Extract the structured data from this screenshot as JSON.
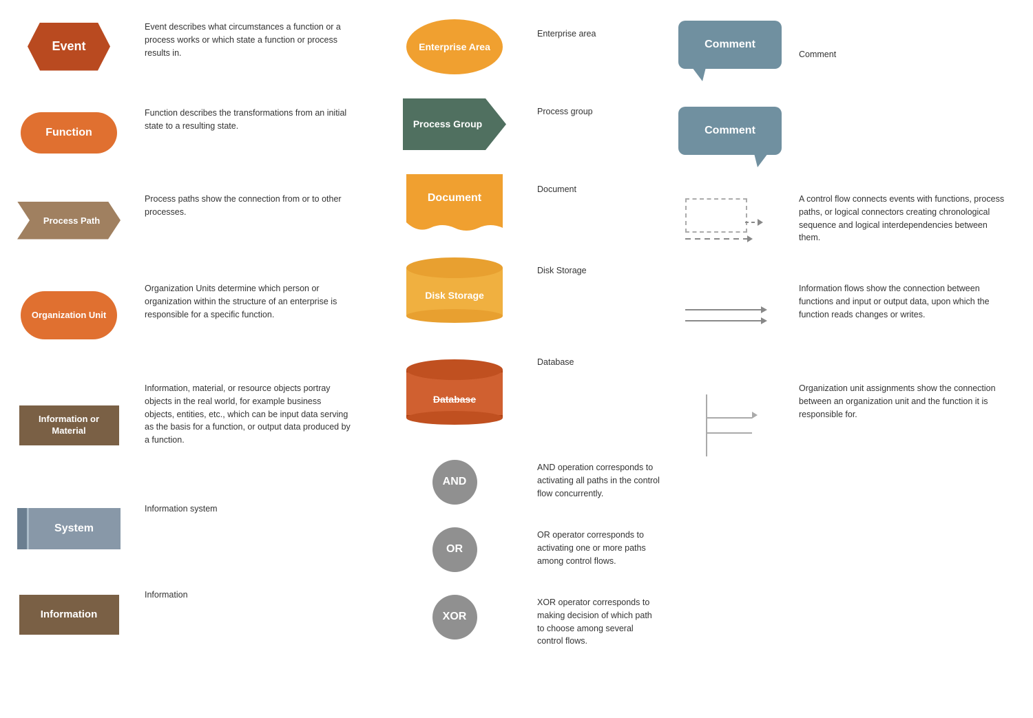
{
  "shapes": {
    "event": {
      "label": "Event",
      "color": "#b94a20"
    },
    "function": {
      "label": "Function",
      "color": "#e07030"
    },
    "process_path": {
      "label": "Process Path",
      "color": "#a08060"
    },
    "org_unit": {
      "label": "Organization Unit",
      "color": "#e07030"
    },
    "info_material": {
      "label": "Information or Material",
      "color": "#7a6045"
    },
    "system": {
      "label": "System",
      "color": "#8898a8"
    },
    "information": {
      "label": "Information",
      "color": "#7a6045"
    },
    "enterprise_area": {
      "label": "Enterprise Area",
      "color": "#f0a030"
    },
    "process_group": {
      "label": "Process Group",
      "color": "#507060"
    },
    "document": {
      "label": "Document",
      "color": "#f0a030"
    },
    "disk_storage": {
      "label": "Disk Storage",
      "color": "#f0b040"
    },
    "database": {
      "label": "Database",
      "color": "#d06030"
    },
    "and_op": {
      "label": "AND",
      "color": "#909090"
    },
    "or_op": {
      "label": "OR",
      "color": "#909090"
    },
    "xor_op": {
      "label": "XOR",
      "color": "#909090"
    },
    "comment1": {
      "label": "Comment",
      "color": "#7090a0"
    },
    "comment2": {
      "label": "Comment",
      "color": "#7090a0"
    }
  },
  "descriptions": {
    "event": "Event describes what circumstances a function or a process works or which state a function or process results in.",
    "function": "Function describes the transformations from an initial state to a resulting state.",
    "process_path": "Process paths show the connection from or to other processes.",
    "org_unit": "Organization Units determine which person or organization within the structure of an enterprise is responsible for a specific function.",
    "info_material": "Information, material, or resource objects portray objects in the real world, for example business objects, entities, etc., which can be input data serving as the basis for a function, or output data produced by a function.",
    "system": "Information system",
    "information": "Information",
    "enterprise_area": "Enterprise area",
    "process_group": "Process group",
    "document": "Document",
    "disk_storage": "Disk Storage",
    "database": "Database",
    "and": "AND operation corresponds to activating all paths in the control flow concurrently.",
    "or": "OR operator corresponds to activating one or more paths among control flows.",
    "xor": "XOR operator corresponds to making decision of which path to choose among several control flows.",
    "comment1": "Comment",
    "comment2": "",
    "control_flow": "A control flow connects events with functions, process paths, or logical connectors creating chronological sequence and logical interdependencies between them.",
    "info_flow": "Information flows show the connection between functions and input or output data, upon which the function reads changes or writes.",
    "org_assign": "Organization unit assignments show the connection between an organization unit and the function it is responsible for."
  }
}
